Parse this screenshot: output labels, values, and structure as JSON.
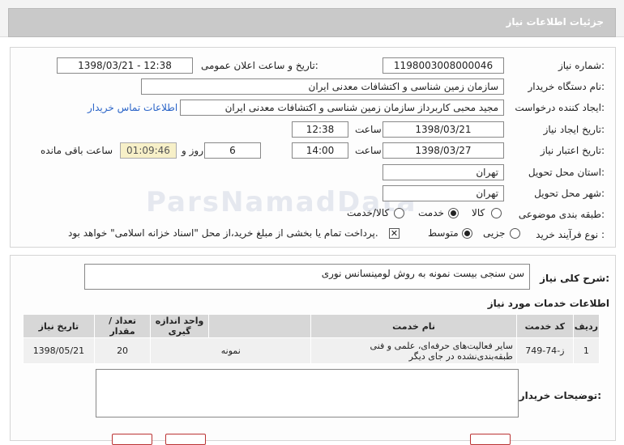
{
  "header": {
    "title": "جزئیات اطلاعات نیاز"
  },
  "form": {
    "need_number_label": "شماره نیاز:",
    "need_number": "1198003008000046",
    "announce_label": "تاریخ و ساعت اعلان عمومی:",
    "announce_value": "1398/03/21 - 12:38",
    "buyer_org_label": "نام دستگاه خریدار:",
    "buyer_org": "سازمان زمین شناسی و اکتشافات معدنی ایران",
    "requester_label": "ایجاد کننده درخواست:",
    "requester": "مجید محبی کاربرداز سازمان زمین شناسی و اکتشافات معدنی ایران",
    "contact_link": "اطلاعات تماس خریدار",
    "created_label": "تاریخ ایجاد نیاز:",
    "created_date": "1398/03/21",
    "time_label": "ساعت",
    "created_time": "12:38",
    "validity_label": "تاریخ اعتبار نیاز:",
    "validity_date": "1398/03/27",
    "validity_time": "14:00",
    "days_value": "6",
    "days_label": "روز و",
    "remaining_time": "01:09:46",
    "remaining_label": "ساعت باقی مانده",
    "province_label": "استان محل تحویل:",
    "province": "تهران",
    "city_label": "شهر محل تحویل:",
    "city": "تهران",
    "category_label": "طبقه بندی موضوعی:",
    "category_options": [
      "کالا",
      "خدمت",
      "کالا/خدمت"
    ],
    "category_selected": "خدمت",
    "process_label": "نوع فرآیند خرید :",
    "process_options": [
      "جزیی",
      "متوسط"
    ],
    "process_selected": "متوسط",
    "payment_note": "پرداخت تمام یا بخشی از مبلغ خرید،از محل \"اسناد خزانه اسلامی\" خواهد بود."
  },
  "summary": {
    "label": "شرح کلی نیاز:",
    "value": "سن سنجی بیست نمونه به روش لومینسانس نوری"
  },
  "services": {
    "title": "اطلاعات خدمات مورد نیاز",
    "columns": [
      "ردیف",
      "کد خدمت",
      "نام خدمت",
      "واحد اندازه گیری",
      "تعداد / مقدار",
      "تاریخ نیاز"
    ],
    "rows": [
      [
        "1",
        "ز-74-749",
        "سایر فعالیت‌های حرفه‌ای، علمی و فنی طبقه‌بندی‌نشده در جای دیگر",
        "نمونه",
        "20",
        "1398/05/21"
      ]
    ]
  },
  "buyer_notes": {
    "label": "توضیحات خریدار:",
    "value": ""
  },
  "watermark": "ParsNamadData"
}
